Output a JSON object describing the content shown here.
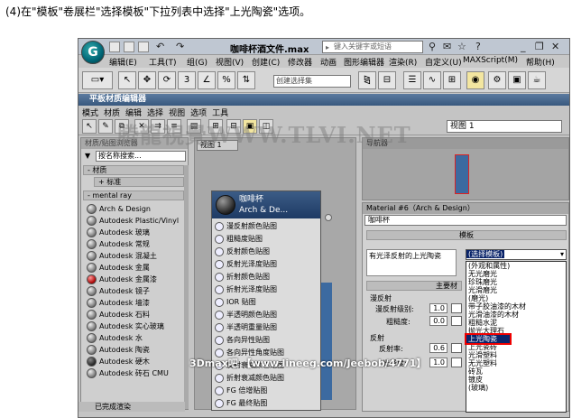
{
  "caption": "(4)在\"模板\"卷展栏\"选择模板\"下拉列表中选择\"上光陶瓷\"选项。",
  "app": {
    "title": "咖啡杯酒文件.max",
    "search_placeholder": "键入关键字或短语",
    "menu": [
      "编辑(E)",
      "工具(T)",
      "组(G)",
      "视图(V)",
      "创建(C)",
      "修改器",
      "动画",
      "图形编辑器",
      "渲染(R)",
      "自定义(U)",
      "MAXScript(M)",
      "帮助(H)"
    ],
    "selection_set_placeholder": "创建选择集"
  },
  "sme": {
    "title": "平板材质编辑器",
    "menu": [
      "模式",
      "材质",
      "编辑",
      "选择",
      "视图",
      "选项",
      "工具"
    ],
    "view_select": "视图 1"
  },
  "browser": {
    "panel_title": "材质/贴图浏览器",
    "search_placeholder": "按名称搜索...",
    "rollouts": [
      "- 材质",
      "+ 标准",
      "- mental ray"
    ],
    "materials": [
      "Arch & Design",
      "Autodesk Plastic/Vinyl",
      "Autodesk 玻璃",
      "Autodesk 常规",
      "Autodesk 混凝土",
      "Autodesk 金属",
      "Autodesk 金属漆",
      "Autodesk 镜子",
      "Autodesk 墙漆",
      "Autodesk 石料",
      "Autodesk 实心玻璃",
      "Autodesk 水",
      "Autodesk 陶瓷",
      "Autodesk 硬木",
      "Autodesk 砖石 CMU"
    ],
    "status": "已完成渲染"
  },
  "view1": {
    "tab": "视图 1",
    "node": {
      "title_line1": "咖啡杯",
      "title_line2": "Arch & De...",
      "slots": [
        "漫反射颜色贴图",
        "粗糙度贴图",
        "反射颜色贴图",
        "反射光泽度贴图",
        "折射颜色贴图",
        "折射光泽度贴图",
        "IOR 贴图",
        "半透明颜色贴图",
        "半透明重量贴图",
        "各向异性贴图",
        "各向异性角度贴图",
        "反射衰减颜色贴图",
        "折射衰减颜色贴图",
        "FG 倍增贴图",
        "FG 最终贴图"
      ]
    }
  },
  "navigator": {
    "title": "导航器"
  },
  "material_panel": {
    "title": "Material #6（Arch & Design）",
    "name": "咖啡杯",
    "template_rollout": "模板",
    "template_desc": "有光泽反射的上光陶瓷",
    "template_current": "(选择模板)",
    "template_options": [
      "(外观和属性)",
      "无光磨光",
      "珍珠磨光",
      "光滑磨光",
      "(磨光)",
      "带子胶油漆的木材",
      "光滑油漆的木材",
      "粗糙水泥",
      "抛光大理石",
      "上光陶瓷",
      "上光瓷砖",
      "光滑塑料",
      "无光塑料",
      "砖瓦",
      "镀皮",
      "(玻璃)"
    ],
    "template_selected": "上光陶瓷",
    "main_rollout": "主要材",
    "diffuse_group": "漫反射",
    "diffuse_level_label": "漫反射级别:",
    "diffuse_level": "1.0",
    "roughness_label": "粗糙度:",
    "roughness": "0.0",
    "reflection_group": "反射",
    "reflectivity_label": "反射率:",
    "reflectivity": "0.6",
    "gloss_label": "光泽度:",
    "gloss": "1.0"
  },
  "watermark": {
    "top": "腾龍視覺WWW.TLVI.NET",
    "bottom": "3Dmax吧 【www.lineeg.com/Jeebob/4771】"
  }
}
